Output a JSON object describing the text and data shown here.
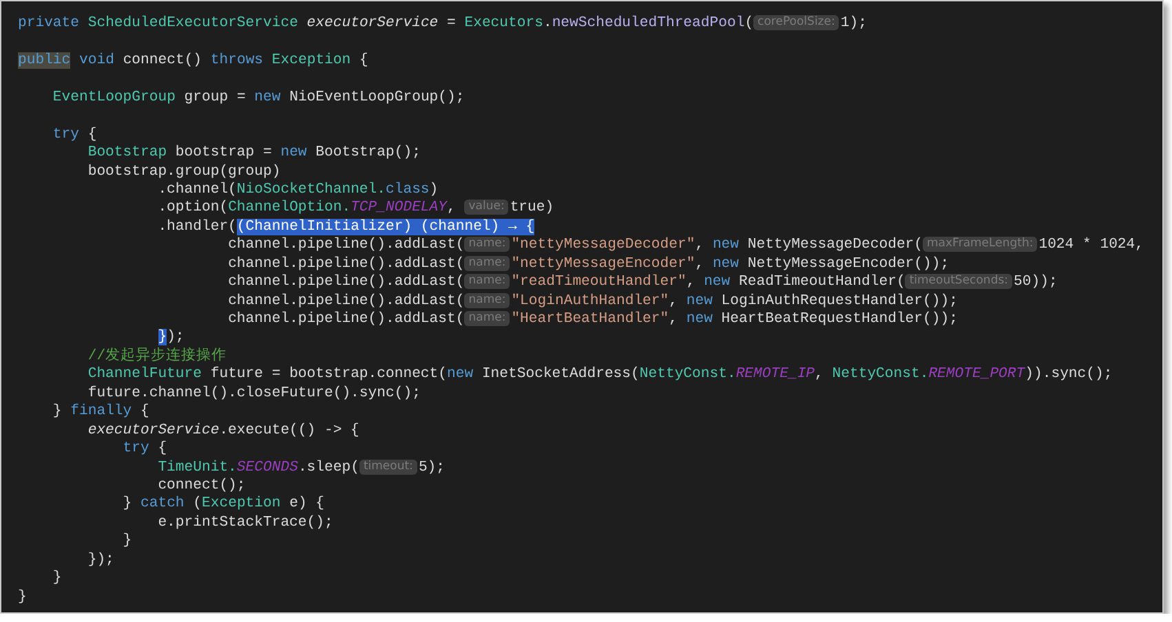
{
  "editor": {
    "lines": [
      {
        "kind": "code",
        "tokens": [
          {
            "kind": "kw",
            "text": "private "
          },
          {
            "kind": "type",
            "text": "ScheduledExecutorService "
          },
          {
            "kind": "field",
            "text": "executorService"
          },
          {
            "kind": "p",
            "text": " = "
          },
          {
            "kind": "type",
            "text": "Executors"
          },
          {
            "kind": "p",
            "text": "."
          },
          {
            "kind": "method",
            "text": "newScheduledThreadPool"
          },
          {
            "kind": "p",
            "text": "("
          },
          {
            "kind": "hint",
            "text": "corePoolSize:"
          },
          {
            "kind": "p",
            "text": "1);"
          }
        ]
      },
      {
        "kind": "blank"
      },
      {
        "kind": "code",
        "tokens": [
          {
            "kind": "hl",
            "text": "public"
          },
          {
            "kind": "kw",
            "text": " void "
          },
          {
            "kind": "p",
            "text": "connect() "
          },
          {
            "kind": "kw",
            "text": "throws "
          },
          {
            "kind": "type",
            "text": "Exception "
          },
          {
            "kind": "p",
            "text": "{"
          }
        ],
        "children": [
          {
            "kind": "blank"
          },
          {
            "kind": "code",
            "tokens": [
              {
                "kind": "type",
                "text": "EventLoopGroup"
              },
              {
                "kind": "p",
                "text": " group = "
              },
              {
                "kind": "kw",
                "text": "new "
              },
              {
                "kind": "p",
                "text": "NioEventLoopGroup();"
              }
            ]
          },
          {
            "kind": "blank"
          },
          {
            "kind": "code",
            "tokens": [
              {
                "kind": "kw",
                "text": "try"
              },
              {
                "kind": "p",
                "text": " {"
              }
            ],
            "children": [
              {
                "kind": "code",
                "tokens": [
                  {
                    "kind": "type",
                    "text": "Bootstrap"
                  },
                  {
                    "kind": "p",
                    "text": " bootstrap = "
                  },
                  {
                    "kind": "kw",
                    "text": "new "
                  },
                  {
                    "kind": "p",
                    "text": "Bootstrap();"
                  }
                ]
              },
              {
                "kind": "code",
                "tokens": [
                  {
                    "kind": "p",
                    "text": "bootstrap.group(group)"
                  }
                ],
                "children": [
                  {
                    "kind": "cont",
                    "tokens": [
                      {
                        "kind": "p",
                        "text": ".channel("
                      },
                      {
                        "kind": "type",
                        "text": "NioSocketChannel."
                      },
                      {
                        "kind": "kw",
                        "text": "class"
                      },
                      {
                        "kind": "p",
                        "text": ")"
                      }
                    ]
                  },
                  {
                    "kind": "cont",
                    "tokens": [
                      {
                        "kind": "p",
                        "text": ".option("
                      },
                      {
                        "kind": "type",
                        "text": "ChannelOption."
                      },
                      {
                        "kind": "const",
                        "text": "TCP_NODELAY"
                      },
                      {
                        "kind": "p",
                        "text": ", "
                      },
                      {
                        "kind": "hint",
                        "text": "value:"
                      },
                      {
                        "kind": "p",
                        "text": "true)"
                      }
                    ]
                  },
                  {
                    "kind": "cont",
                    "tokens": [
                      {
                        "kind": "p",
                        "text": ".handler("
                      },
                      {
                        "kind": "sel",
                        "text": "(ChannelInitializer) (channel) → {"
                      }
                    ],
                    "children": [
                      {
                        "kind": "code",
                        "tokens": [
                          {
                            "kind": "p",
                            "text": "channel.pipeline().addLast("
                          },
                          {
                            "kind": "hint",
                            "text": "name:"
                          },
                          {
                            "kind": "str",
                            "text": "\"nettyMessageDecoder\""
                          },
                          {
                            "kind": "p",
                            "text": ", "
                          },
                          {
                            "kind": "kw",
                            "text": "new "
                          },
                          {
                            "kind": "p",
                            "text": "NettyMessageDecoder("
                          },
                          {
                            "kind": "hint",
                            "text": "maxFrameLength:"
                          },
                          {
                            "kind": "p",
                            "text": "1024 * 1024,"
                          }
                        ]
                      },
                      {
                        "kind": "code",
                        "tokens": [
                          {
                            "kind": "p",
                            "text": "channel.pipeline().addLast("
                          },
                          {
                            "kind": "hint",
                            "text": "name:"
                          },
                          {
                            "kind": "str",
                            "text": "\"nettyMessageEncoder\""
                          },
                          {
                            "kind": "p",
                            "text": ", "
                          },
                          {
                            "kind": "kw",
                            "text": "new "
                          },
                          {
                            "kind": "p",
                            "text": "NettyMessageEncoder());"
                          }
                        ]
                      },
                      {
                        "kind": "code",
                        "tokens": [
                          {
                            "kind": "p",
                            "text": "channel.pipeline().addLast("
                          },
                          {
                            "kind": "hint",
                            "text": "name:"
                          },
                          {
                            "kind": "str",
                            "text": "\"readTimeoutHandler\""
                          },
                          {
                            "kind": "p",
                            "text": ", "
                          },
                          {
                            "kind": "kw",
                            "text": "new "
                          },
                          {
                            "kind": "p",
                            "text": "ReadTimeoutHandler("
                          },
                          {
                            "kind": "hint",
                            "text": "timeoutSeconds:"
                          },
                          {
                            "kind": "p",
                            "text": "50));"
                          }
                        ]
                      },
                      {
                        "kind": "code",
                        "tokens": [
                          {
                            "kind": "p",
                            "text": "channel.pipeline().addLast("
                          },
                          {
                            "kind": "hint",
                            "text": "name:"
                          },
                          {
                            "kind": "str",
                            "text": "\"LoginAuthHandler\""
                          },
                          {
                            "kind": "p",
                            "text": ", "
                          },
                          {
                            "kind": "kw",
                            "text": "new "
                          },
                          {
                            "kind": "p",
                            "text": "LoginAuthRequestHandler());"
                          }
                        ]
                      },
                      {
                        "kind": "code",
                        "tokens": [
                          {
                            "kind": "p",
                            "text": "channel.pipeline().addLast("
                          },
                          {
                            "kind": "hint",
                            "text": "name:"
                          },
                          {
                            "kind": "str",
                            "text": "\"HeartBeatHandler\""
                          },
                          {
                            "kind": "p",
                            "text": ", "
                          },
                          {
                            "kind": "kw",
                            "text": "new "
                          },
                          {
                            "kind": "p",
                            "text": "HeartBeatRequestHandler());"
                          }
                        ]
                      }
                    ]
                  },
                  {
                    "kind": "cont",
                    "tokens": [
                      {
                        "kind": "sel",
                        "text": "}"
                      },
                      {
                        "kind": "p",
                        "text": ");"
                      }
                    ]
                  }
                ]
              },
              {
                "kind": "code",
                "tokens": [
                  {
                    "kind": "comment",
                    "text": "//发起异步连接操作"
                  }
                ]
              },
              {
                "kind": "code",
                "tokens": [
                  {
                    "kind": "type",
                    "text": "ChannelFuture"
                  },
                  {
                    "kind": "p",
                    "text": " future = bootstrap.connect("
                  },
                  {
                    "kind": "kw",
                    "text": "new "
                  },
                  {
                    "kind": "p",
                    "text": "InetSocketAddress("
                  },
                  {
                    "kind": "type",
                    "text": "NettyConst."
                  },
                  {
                    "kind": "const",
                    "text": "REMOTE_IP"
                  },
                  {
                    "kind": "p",
                    "text": ", "
                  },
                  {
                    "kind": "type",
                    "text": "NettyConst."
                  },
                  {
                    "kind": "const",
                    "text": "REMOTE_PORT"
                  },
                  {
                    "kind": "p",
                    "text": ")).sync();"
                  }
                ]
              },
              {
                "kind": "code",
                "tokens": [
                  {
                    "kind": "p",
                    "text": "future.channel().closeFuture().sync();"
                  }
                ]
              }
            ]
          },
          {
            "kind": "code",
            "tokens": [
              {
                "kind": "p",
                "text": "} "
              },
              {
                "kind": "kw",
                "text": "finally"
              },
              {
                "kind": "p",
                "text": " {"
              }
            ],
            "children": [
              {
                "kind": "code",
                "tokens": [
                  {
                    "kind": "field",
                    "text": "executorService"
                  },
                  {
                    "kind": "p",
                    "text": ".execute(() -> {"
                  }
                ],
                "children": [
                  {
                    "kind": "code",
                    "tokens": [
                      {
                        "kind": "kw",
                        "text": "try"
                      },
                      {
                        "kind": "p",
                        "text": " {"
                      }
                    ],
                    "children": [
                      {
                        "kind": "code",
                        "tokens": [
                          {
                            "kind": "type",
                            "text": "TimeUnit."
                          },
                          {
                            "kind": "const",
                            "text": "SECONDS"
                          },
                          {
                            "kind": "p",
                            "text": ".sleep("
                          },
                          {
                            "kind": "hint",
                            "text": "timeout:"
                          },
                          {
                            "kind": "p",
                            "text": "5);"
                          }
                        ]
                      },
                      {
                        "kind": "code",
                        "tokens": [
                          {
                            "kind": "p",
                            "text": "connect();"
                          }
                        ]
                      }
                    ]
                  },
                  {
                    "kind": "code",
                    "tokens": [
                      {
                        "kind": "p",
                        "text": "} "
                      },
                      {
                        "kind": "kw",
                        "text": "catch"
                      },
                      {
                        "kind": "p",
                        "text": " ("
                      },
                      {
                        "kind": "type",
                        "text": "Exception"
                      },
                      {
                        "kind": "p",
                        "text": " e) {"
                      }
                    ],
                    "children": [
                      {
                        "kind": "code",
                        "tokens": [
                          {
                            "kind": "p",
                            "text": "e.printStackTrace();"
                          }
                        ]
                      }
                    ]
                  },
                  {
                    "kind": "code",
                    "tokens": [
                      {
                        "kind": "p",
                        "text": "}"
                      }
                    ]
                  }
                ]
              },
              {
                "kind": "code",
                "tokens": [
                  {
                    "kind": "p",
                    "text": "});"
                  }
                ]
              }
            ]
          },
          {
            "kind": "code",
            "tokens": [
              {
                "kind": "p",
                "text": "}"
              }
            ]
          }
        ]
      },
      {
        "kind": "code",
        "tokens": [
          {
            "kind": "p",
            "text": "}"
          }
        ]
      }
    ]
  }
}
